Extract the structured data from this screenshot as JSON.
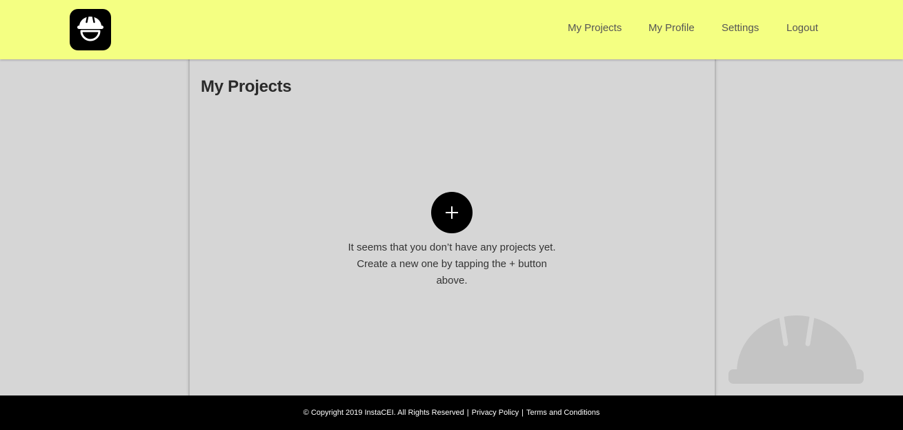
{
  "header": {
    "logo_icon": "helmet-icon",
    "background_color": "#f4ff82",
    "nav": [
      {
        "label": "My Projects"
      },
      {
        "label": "My Profile"
      },
      {
        "label": "Settings"
      },
      {
        "label": "Logout"
      }
    ]
  },
  "main": {
    "title": "My Projects",
    "add_button_icon": "plus-icon",
    "empty_message": "It seems that you don’t have any projects yet. Create a new one by tapping the + button above."
  },
  "background": {
    "decoration_icon": "helmet-icon"
  },
  "footer": {
    "copyright": "© Copyright 2019 InstaCEI. All Rights Reserved",
    "separator": "|",
    "privacy_link": "Privacy Policy",
    "terms_link": "Terms and Conditions"
  }
}
